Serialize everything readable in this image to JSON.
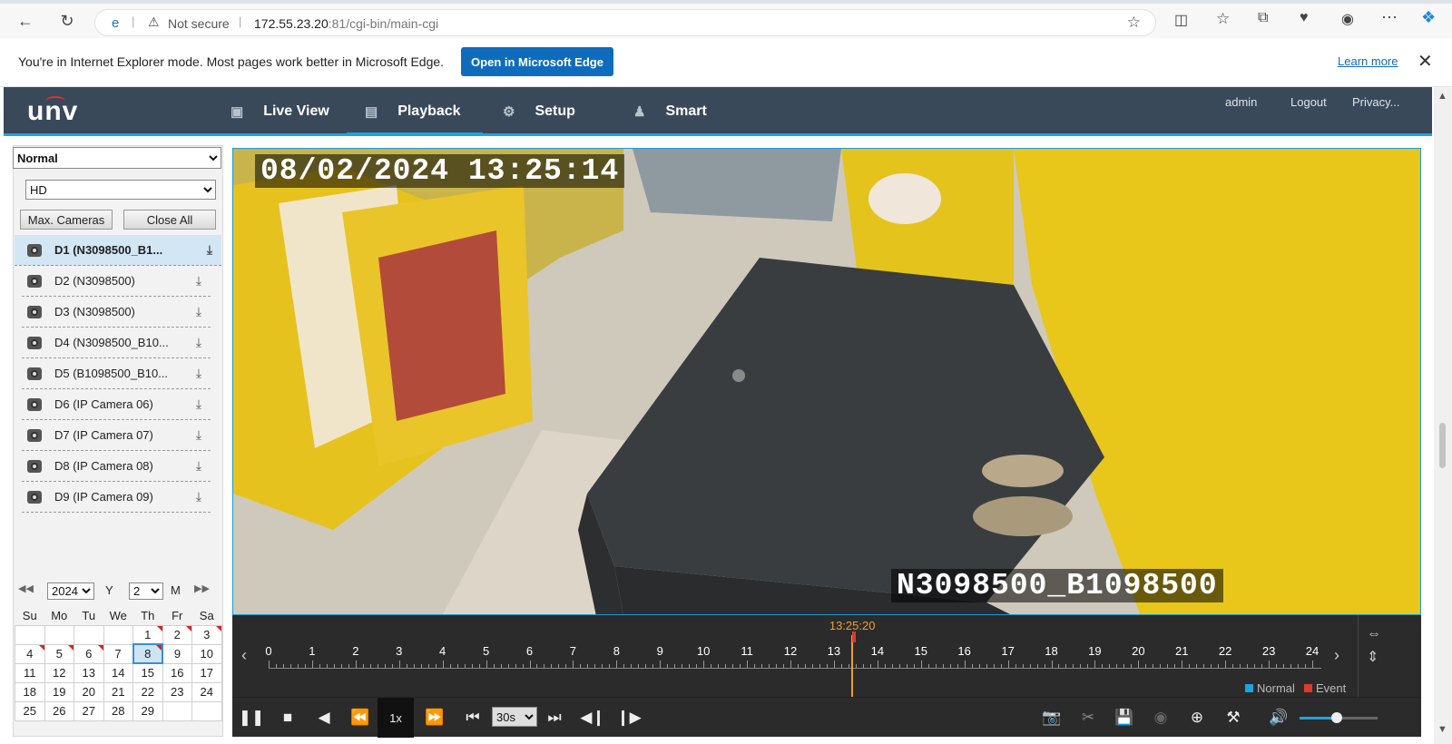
{
  "browser": {
    "back_icon": "arrow-left-icon",
    "refresh_icon": "refresh-icon",
    "security_label": "Not secure",
    "url_host": "172.55.23.20",
    "url_rest": ":81/cgi-bin/main-cgi"
  },
  "iebar": {
    "message": "You're in Internet Explorer mode. Most pages work better in Microsoft Edge.",
    "open_button": "Open in Microsoft Edge",
    "learn_more": "Learn more"
  },
  "app": {
    "logo": "unv",
    "nav": [
      {
        "label": "Live View",
        "icon": "monitor-icon"
      },
      {
        "label": "Playback",
        "icon": "playback-icon",
        "active": true
      },
      {
        "label": "Setup",
        "icon": "gear-icon"
      },
      {
        "label": "Smart",
        "icon": "smart-icon"
      }
    ],
    "user": "admin",
    "logout": "Logout",
    "privacy": "Privacy..."
  },
  "sidebar": {
    "mode": "Normal",
    "quality": "HD",
    "max_cameras": "Max. Cameras",
    "close_all": "Close All",
    "cameras": [
      {
        "label": "D1 (N3098500_B1...",
        "selected": true
      },
      {
        "label": "D2 (N3098500)"
      },
      {
        "label": "D3 (N3098500)"
      },
      {
        "label": "D4 (N3098500_B10..."
      },
      {
        "label": "D5 (B1098500_B10..."
      },
      {
        "label": "D6 (IP Camera 06)"
      },
      {
        "label": "D7 (IP Camera 07)"
      },
      {
        "label": "D8 (IP Camera 08)"
      },
      {
        "label": "D9 (IP Camera 09)"
      }
    ]
  },
  "calendar": {
    "year": "2024",
    "year_unit": "Y",
    "month": "2",
    "month_unit": "M",
    "weekdays": [
      "Su",
      "Mo",
      "Tu",
      "We",
      "Th",
      "Fr",
      "Sa"
    ],
    "weeks": [
      [
        "",
        "",
        "",
        "",
        "1",
        "2",
        "3"
      ],
      [
        "4",
        "5",
        "6",
        "7",
        "8",
        "9",
        "10"
      ],
      [
        "11",
        "12",
        "13",
        "14",
        "15",
        "16",
        "17"
      ],
      [
        "18",
        "19",
        "20",
        "21",
        "22",
        "23",
        "24"
      ],
      [
        "25",
        "26",
        "27",
        "28",
        "29",
        "",
        ""
      ]
    ],
    "event_days": [
      "1",
      "2",
      "3",
      "4",
      "5",
      "6",
      "8"
    ],
    "selected_day": "8"
  },
  "video": {
    "timestamp": "08/02/2024 13:25:14",
    "camera_name": "N3098500_B1098500"
  },
  "timeline": {
    "cursor_time": "13:25:20",
    "hours": [
      "0",
      "1",
      "2",
      "3",
      "4",
      "5",
      "6",
      "7",
      "8",
      "9",
      "10",
      "11",
      "12",
      "13",
      "14",
      "15",
      "16",
      "17",
      "18",
      "19",
      "20",
      "21",
      "22",
      "23",
      "24"
    ],
    "legend_normal": "Normal",
    "legend_event": "Event",
    "normal_color": "#1fa3e0",
    "event_color": "#e03a2a"
  },
  "controls": {
    "speed": "1x",
    "interval": "30s",
    "volume_level": 0.48
  }
}
